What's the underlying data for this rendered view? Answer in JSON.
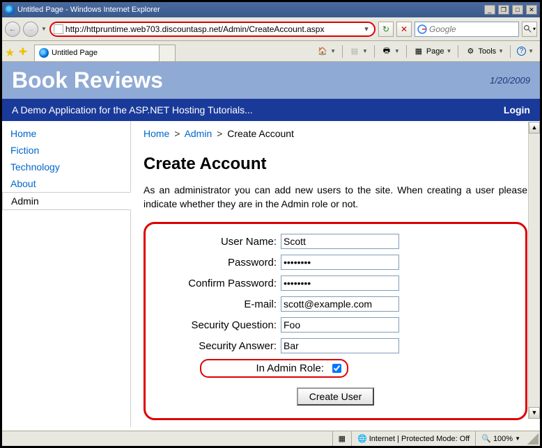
{
  "window": {
    "title": "Untitled Page - Windows Internet Explorer"
  },
  "address": {
    "url": "http://httpruntime.web703.discountasp.net/Admin/CreateAccount.aspx"
  },
  "search": {
    "placeholder": "Google"
  },
  "tab": {
    "label": "Untitled Page"
  },
  "toolbar": {
    "page": "Page",
    "tools": "Tools"
  },
  "site": {
    "title": "Book Reviews",
    "date": "1/20/2009",
    "tagline": "A Demo Application for the ASP.NET Hosting Tutorials...",
    "login": "Login"
  },
  "nav": {
    "items": [
      {
        "label": "Home"
      },
      {
        "label": "Fiction"
      },
      {
        "label": "Technology"
      },
      {
        "label": "About"
      },
      {
        "label": "Admin"
      }
    ]
  },
  "breadcrumb": {
    "home": "Home",
    "admin": "Admin",
    "current": "Create Account"
  },
  "content": {
    "heading": "Create Account",
    "intro": "As an administrator you can add new users to the site. When creating a user please indicate whether they are in the Admin role or not."
  },
  "form": {
    "username_label": "User Name:",
    "username_value": "Scott",
    "password_label": "Password:",
    "password_value": "••••••••",
    "confirm_label": "Confirm Password:",
    "confirm_value": "••••••••",
    "email_label": "E-mail:",
    "email_value": "scott@example.com",
    "question_label": "Security Question:",
    "question_value": "Foo",
    "answer_label": "Security Answer:",
    "answer_value": "Bar",
    "adminrole_label": "In Admin Role:",
    "adminrole_checked": true,
    "submit_label": "Create User"
  },
  "status": {
    "zone": "Internet | Protected Mode: Off",
    "zoom": "100%"
  }
}
